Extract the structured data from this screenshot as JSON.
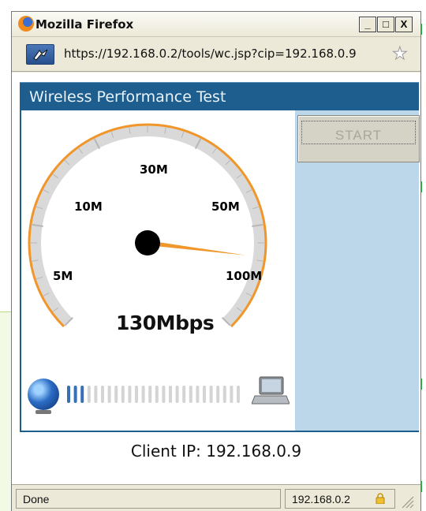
{
  "window": {
    "title": "Mozilla Firefox",
    "buttons": {
      "minimize": "_",
      "maximize": "□",
      "close": "X"
    },
    "url": "https://192.168.0.2/tools/wc.jsp?cip=192.168.0.9"
  },
  "app": {
    "title": "Wireless Performance Test",
    "start_label": "START",
    "gauge": {
      "labels": [
        "5M",
        "10M",
        "30M",
        "50M",
        "100M"
      ],
      "value_text": "130Mbps",
      "needle_level": 1.0,
      "arc_color": "#f0962a",
      "needle_color": "#f0962a"
    },
    "client_ip": "Client IP: 192.168.0.9"
  },
  "status": {
    "text": "Done",
    "host": "192.168.0.2"
  },
  "colors": {
    "header_bg": "#1d5e8e",
    "side_panel": "#bcd6ea",
    "signal_active": "#3a6fb8",
    "signal_inactive": "#d4d4d4"
  }
}
